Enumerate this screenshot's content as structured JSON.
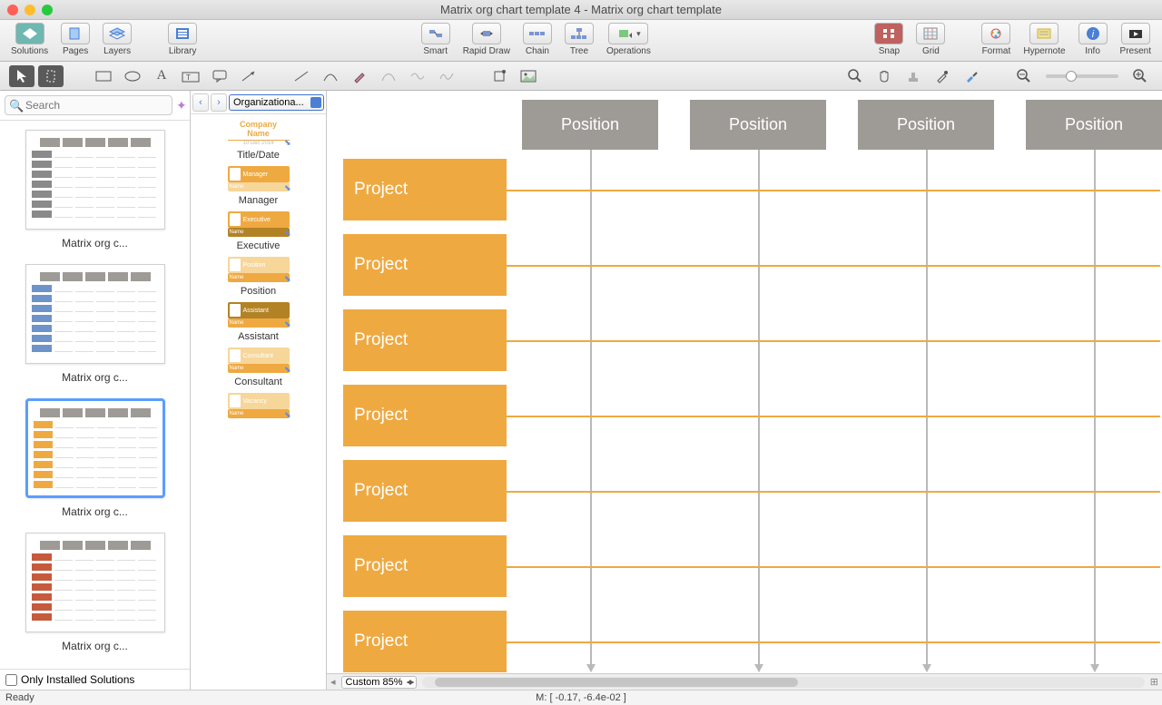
{
  "window": {
    "title": "Matrix org chart template 4 - Matrix org chart template"
  },
  "toolbar": {
    "solutions": "Solutions",
    "pages": "Pages",
    "layers": "Layers",
    "library": "Library",
    "smart": "Smart",
    "rapid_draw": "Rapid Draw",
    "chain": "Chain",
    "tree": "Tree",
    "operations": "Operations",
    "snap": "Snap",
    "grid": "Grid",
    "format": "Format",
    "hypernote": "Hypernote",
    "info": "Info",
    "present": "Present"
  },
  "search": {
    "placeholder": "Search"
  },
  "thumbs": [
    {
      "label": "Matrix org c...",
      "variant": "grey"
    },
    {
      "label": "Matrix org c...",
      "variant": "blue"
    },
    {
      "label": "Matrix org c...",
      "variant": "orange",
      "selected": true
    },
    {
      "label": "Matrix org c...",
      "variant": "red"
    }
  ],
  "only_installed": "Only Installed Solutions",
  "library": {
    "selector": "Organizationa...",
    "company_name": "Company Name",
    "items": [
      {
        "caption": "Title/Date",
        "type": "titledate"
      },
      {
        "caption": "Manager",
        "type": "manager",
        "badge": "Manager",
        "name_row": "Name",
        "top_color": "#efa941",
        "bottom_color": "#f7d69a"
      },
      {
        "caption": "Executive",
        "type": "executive",
        "badge": "Executive",
        "name_row": "Name",
        "top_color": "#efa941",
        "bottom_color": "#b38225"
      },
      {
        "caption": "Position",
        "type": "position",
        "badge": "Position",
        "name_row": "Name",
        "top_color": "#f7d69a",
        "bottom_color": "#efa941"
      },
      {
        "caption": "Assistant",
        "type": "assistant",
        "badge": "Assistant",
        "name_row": "Name",
        "top_color": "#b38225",
        "bottom_color": "#efa941"
      },
      {
        "caption": "Consultant",
        "type": "consultant",
        "badge": "Consultant",
        "name_row": "Name",
        "top_color": "#f7d69a",
        "bottom_color": "#efa941"
      },
      {
        "caption": "",
        "type": "vacancy",
        "badge": "Vacancy",
        "name_row": "Name",
        "top_color": "#f7d69a",
        "bottom_color": "#efa941"
      }
    ]
  },
  "canvas": {
    "positions": [
      "Position",
      "Position",
      "Position",
      "Position"
    ],
    "projects": [
      "Project",
      "Project",
      "Project",
      "Project",
      "Project",
      "Project",
      "Project"
    ]
  },
  "bottombar": {
    "zoom": "Custom 85%"
  },
  "status": {
    "left": "Ready",
    "center": "M: [ -0.17, -6.4e-02 ]"
  }
}
